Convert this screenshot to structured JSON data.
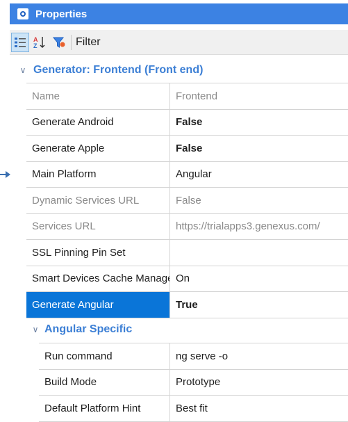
{
  "panel": {
    "title": "Properties",
    "icon": "properties-icon"
  },
  "toolbar": {
    "filter_label": "Filter",
    "buttons": [
      "categorized-view-icon",
      "sort-alphabetical-icon",
      "filter-funnel-icon"
    ]
  },
  "group": {
    "title": "Generator: Frontend (Front end)"
  },
  "rows": [
    {
      "name": "Name",
      "value": "Frontend"
    },
    {
      "name": "Generate Android",
      "value": "False"
    },
    {
      "name": "Generate Apple",
      "value": "False"
    },
    {
      "name": "Main Platform",
      "value": "Angular"
    },
    {
      "name": "Dynamic Services URL",
      "value": "False"
    },
    {
      "name": "Services URL",
      "value": "https://trialapps3.genexus.com/"
    },
    {
      "name": "SSL Pinning Pin Set",
      "value": ""
    },
    {
      "name": "Smart Devices Cache Management",
      "value": "On"
    },
    {
      "name": "Generate Angular",
      "value": "True"
    }
  ],
  "subgroup": {
    "title": "Angular Specific"
  },
  "subrows": [
    {
      "name": "Run command",
      "value": "ng serve -o"
    },
    {
      "name": "Build Mode",
      "value": "Prototype"
    },
    {
      "name": "Default Platform Hint",
      "value": "Best fit"
    }
  ],
  "colors": {
    "title_bar": "#3c82e3",
    "selection": "#0a75d8",
    "group_text": "#3c7fd5"
  }
}
